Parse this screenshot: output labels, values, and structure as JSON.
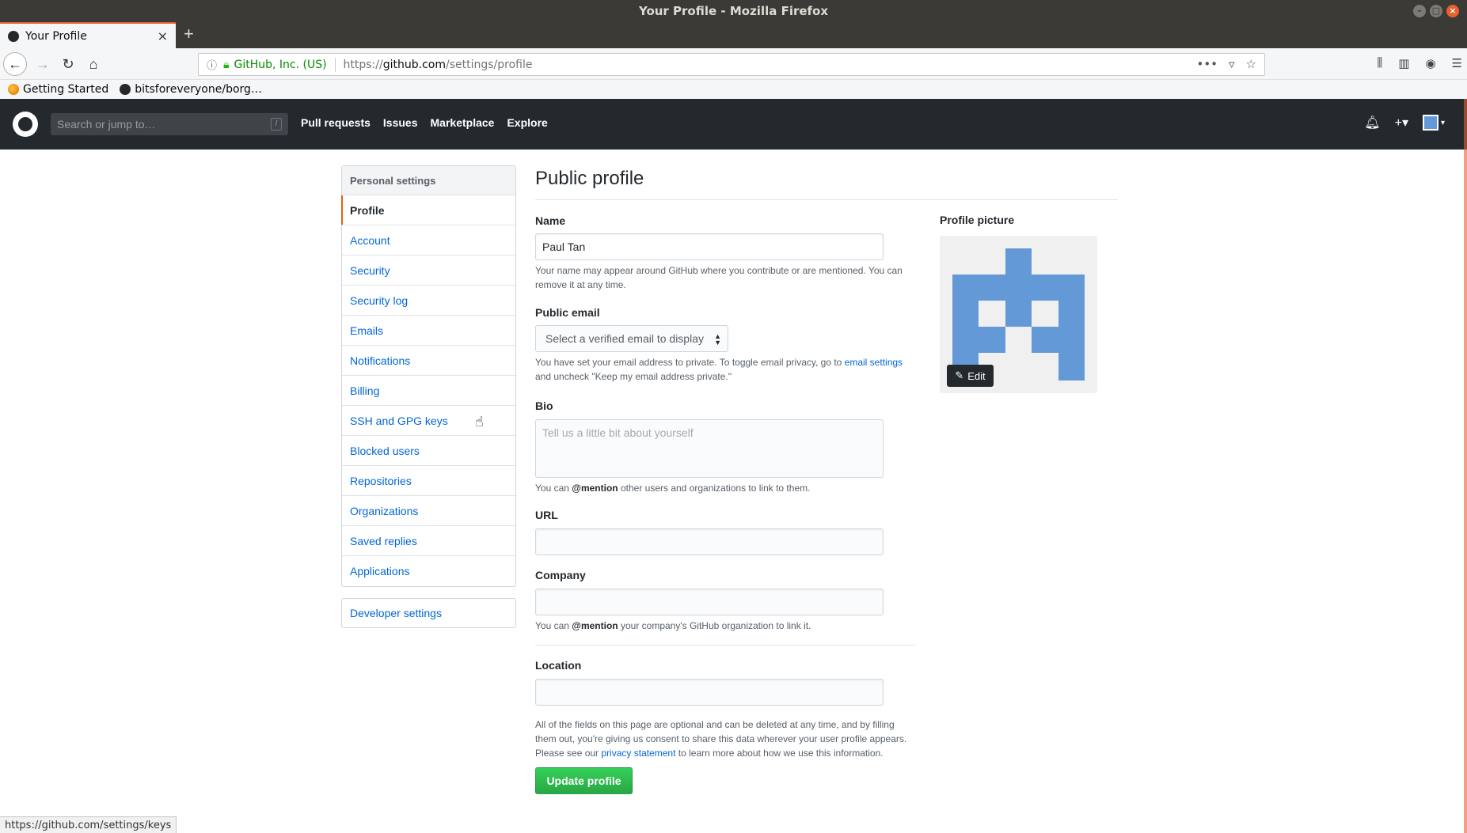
{
  "window": {
    "title": "Your Profile - Mozilla Firefox"
  },
  "tab": {
    "title": "Your Profile",
    "close": "×",
    "new": "+"
  },
  "urlbar": {
    "org": "GitHub, Inc. (US)",
    "url_prefix": "https://",
    "url_host": "github.com",
    "url_path": "/settings/profile"
  },
  "bookmarks": [
    {
      "label": "Getting Started",
      "icon": "firefox-icon"
    },
    {
      "label": "bitsforeveryone/borg…",
      "icon": "github-icon"
    }
  ],
  "gh_header": {
    "search_placeholder": "Search or jump to…",
    "search_key": "/",
    "nav": [
      "Pull requests",
      "Issues",
      "Marketplace",
      "Explore"
    ]
  },
  "sidebar": {
    "heading": "Personal settings",
    "items": [
      {
        "label": "Profile",
        "selected": true
      },
      {
        "label": "Account"
      },
      {
        "label": "Security"
      },
      {
        "label": "Security log"
      },
      {
        "label": "Emails"
      },
      {
        "label": "Notifications"
      },
      {
        "label": "Billing"
      },
      {
        "label": "SSH and GPG keys"
      },
      {
        "label": "Blocked users"
      },
      {
        "label": "Repositories"
      },
      {
        "label": "Organizations"
      },
      {
        "label": "Saved replies"
      },
      {
        "label": "Applications"
      }
    ],
    "developer": "Developer settings"
  },
  "form": {
    "title": "Public profile",
    "name_label": "Name",
    "name_value": "Paul Tan",
    "name_note": "Your name may appear around GitHub where you contribute or are mentioned. You can remove it at any time.",
    "email_label": "Public email",
    "email_select": "Select a verified email to display",
    "email_note_1": "You have set your email address to private. To toggle email privacy, go to ",
    "email_note_link": "email settings",
    "email_note_2": " and uncheck \"Keep my email address private.\"",
    "bio_label": "Bio",
    "bio_placeholder": "Tell us a little bit about yourself",
    "mention_prefix": "You can ",
    "mention_word": "@mention",
    "bio_note_rest": " other users and organizations to link to them.",
    "url_label": "URL",
    "company_label": "Company",
    "company_note_rest": " your company's GitHub organization to link it.",
    "location_label": "Location",
    "footer_note_1": "All of the fields on this page are optional and can be deleted at any time, and by filling them out, you're giving us consent to share this data wherever your user profile appears. Please see our ",
    "footer_note_link": "privacy statement",
    "footer_note_2": " to learn more about how we use this information.",
    "submit": "Update profile"
  },
  "profile_picture": {
    "label": "Profile picture",
    "edit": "Edit"
  },
  "status_url": "https://github.com/settings/keys",
  "colors": {
    "accent": "#e36209",
    "link": "#0366d6",
    "button": "#28a745",
    "avatar": "#6499d8"
  }
}
